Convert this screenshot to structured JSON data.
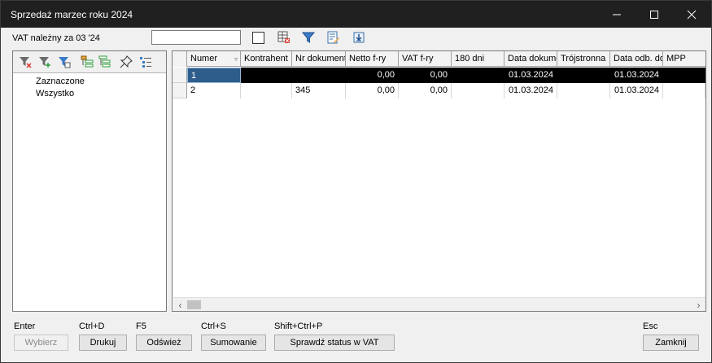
{
  "window": {
    "title": "Sprzedaż marzec roku 2024",
    "minimize_glyph": "—",
    "maximize_glyph": "☐",
    "close_glyph": "✕"
  },
  "toolbar": {
    "vat_label": "VAT należny za 03 '24",
    "search_value": "",
    "icons": [
      "table-export-icon",
      "filter-icon",
      "edit-document-icon",
      "download-icon"
    ]
  },
  "left_panel": {
    "toolbar_icons": [
      "filter-clear-icon",
      "filter-add-icon",
      "filter-table-icon",
      "tree-collapse-icon",
      "tree-expand-icon",
      "pin-icon",
      "list-tree-icon"
    ],
    "items": [
      {
        "label": "Zaznaczone"
      },
      {
        "label": "Wszystko"
      }
    ]
  },
  "grid": {
    "columns": [
      "Numer",
      "Kontrahent",
      "Nr dokumentu",
      "Netto f-ry",
      "VAT f-ry",
      "180 dni",
      "Data dokumentu",
      "Trójstronna",
      "Data odb. dok.",
      "MPP"
    ],
    "rows": [
      [
        "1",
        "",
        "",
        "0,00",
        "0,00",
        "",
        "01.03.2024",
        "",
        "01.03.2024",
        ""
      ],
      [
        "2",
        "",
        "345",
        "0,00",
        "0,00",
        "",
        "01.03.2024",
        "",
        "01.03.2024",
        ""
      ]
    ],
    "selected_row": 0
  },
  "footer": {
    "shortcuts": {
      "select": "Enter",
      "print": "Ctrl+D",
      "refresh": "F5",
      "sum": "Ctrl+S",
      "vat_status": "Shift+Ctrl+P",
      "close": "Esc"
    },
    "buttons": {
      "select": "Wybierz",
      "print": "Drukuj",
      "refresh": "Odśwież",
      "sum": "Sumowanie",
      "vat_status": "Sprawdź status w VAT",
      "close": "Zamknij"
    }
  },
  "colors": {
    "titlebar": "#202020",
    "selected_row": "#000000",
    "focus_cell": "#2e5d8c"
  }
}
